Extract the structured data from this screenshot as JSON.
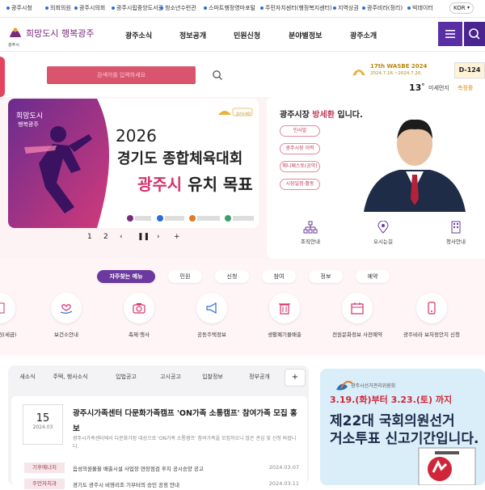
{
  "top_links": [
    "광주시청",
    "의회의원",
    "광주시의회",
    "광주시립중앙도서관",
    "청소년수련관",
    "스마트행정영마포털",
    "주민자치센터(행정복지센터)",
    "지역상권",
    "광주비라(정리)",
    "빅데이터"
  ],
  "language": "KOR",
  "logo": {
    "text": "희망도시 행복광주",
    "sub": "광주시"
  },
  "nav": [
    "광주소식",
    "정보공개",
    "민원신청",
    "분야별정보",
    "광주소개"
  ],
  "search": {
    "placeholder": "검색어를 입력하세요"
  },
  "event": {
    "name": "17th WASBE 2024",
    "dates": "2024.7.16.~2024.7.20.",
    "dday": "D-124"
  },
  "weather": {
    "temp": "13",
    "unit": "°",
    "label": "미세먼지",
    "value": "측정중"
  },
  "banner": {
    "year": "2026",
    "line2": "경기도 종합체육대회",
    "line3_highlight": "광주시",
    "line3_rest": " 유치 목표",
    "brand": "경기도체전",
    "brand_slogan": "광주시 행복광주"
  },
  "banner_controls": [
    "1",
    "2",
    "‹",
    "❚❚",
    "›",
    "+"
  ],
  "mayor": {
    "title_prefix": "광주시장 ",
    "name": "방세환",
    "title_suffix": " 입니다.",
    "links": [
      "인사말",
      "광주시장 이력",
      "매니페스토(공약)",
      "시장일정·활동",
      "시장에게 바란다"
    ],
    "pills": [
      "인사말",
      "광주시장 이력",
      "매니페스토(공약)",
      "시장일정·활동"
    ]
  },
  "quick_links": [
    "조직안내",
    "오시는길",
    "청사안내"
  ],
  "freq": {
    "tabs": [
      "자주찾는 메뉴",
      "민원",
      "신청",
      "참여",
      "정보",
      "예약"
    ],
    "services": [
      "전자민원(세금)",
      "보건소안내",
      "축제·행사",
      "공동주택정보",
      "생활폐기물배출",
      "전원문화정보 사전예약",
      "광주비라 보차정안지 신청"
    ]
  },
  "news": {
    "tabs": [
      "새소식",
      "주택, 행사소식",
      "입법공고",
      "고시공고",
      "입찰정보",
      "정부공개"
    ],
    "more": "+",
    "featured": {
      "day": "15",
      "ym": "2024.03",
      "title": "광주시가족센터 다문화가족캠프 'ON가족 소통캠프' 참여가족 모집 홍보",
      "summary": "광주시가족센터에서 다문화가정 대상으로 'ON가족 소통캠프' 참여가족을 모집하오니 많은 관심 및 신청 바랍니다."
    },
    "rows": [
      {
        "cat": "기후에너지",
        "title": "음성의원물을 배출시설 사업장 연장점검 후지 공시승양 공고",
        "date": "2024.03.07"
      },
      {
        "cat": "주민자치과",
        "title": "경기도 광주시 비영리조 기부터의 승인 공정 안내",
        "date": "2024.03.11"
      }
    ]
  },
  "promo": {
    "org": "광주시선거관리위원회",
    "dates": "3.19.(화)부터 3.23.(토) 까지",
    "title1": "제22대 국회의원선거",
    "title2": "거소투표 신고기간입니다."
  },
  "colors": {
    "accent": "#5a2fa6",
    "pink": "#d9556d",
    "highlight": "#d4336b"
  }
}
